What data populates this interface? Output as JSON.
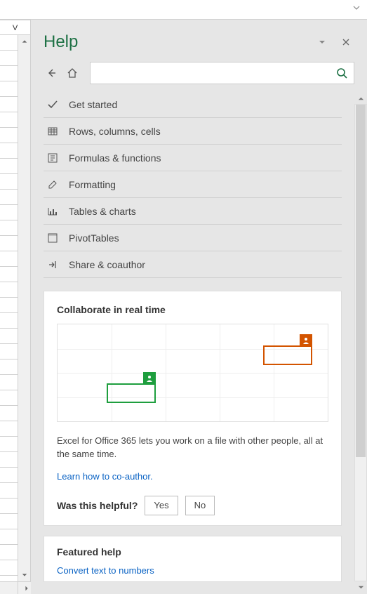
{
  "column_header": "V",
  "pane": {
    "title": "Help",
    "search_placeholder": ""
  },
  "topics": [
    {
      "icon": "check-icon",
      "label": "Get started"
    },
    {
      "icon": "table-icon",
      "label": "Rows, columns, cells"
    },
    {
      "icon": "function-icon",
      "label": "Formulas & functions"
    },
    {
      "icon": "edit-icon",
      "label": "Formatting"
    },
    {
      "icon": "chart-icon",
      "label": "Tables & charts"
    },
    {
      "icon": "pivot-icon",
      "label": "PivotTables"
    },
    {
      "icon": "share-icon",
      "label": "Share & coauthor"
    }
  ],
  "collab": {
    "heading": "Collaborate in real time",
    "description": "Excel for Office 365 lets you work on a file with other people, all at the same time.",
    "link_text": "Learn how to co-author.",
    "feedback_q": "Was this helpful?",
    "yes": "Yes",
    "no": "No"
  },
  "featured": {
    "heading": "Featured help",
    "link1": "Convert text to numbers"
  }
}
